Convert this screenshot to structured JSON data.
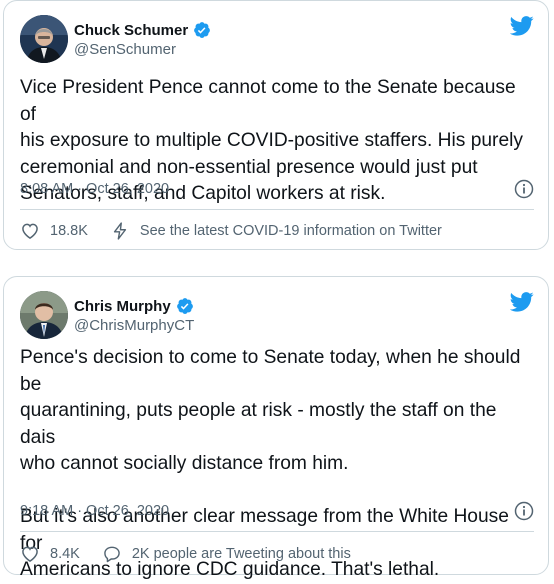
{
  "tweets": [
    {
      "name": "Chuck Schumer",
      "handle": "@SenSchumer",
      "text": "Vice President Pence cannot come to the Senate because of\nhis exposure to multiple COVID-positive staffers. His purely\nceremonial and non-essential presence would just put\nSenators, staff, and Capitol workers at risk.",
      "time": "8:08 AM",
      "sep": "·",
      "date": "Oct 26, 2020",
      "likes": "18.8K",
      "info_link": "See the latest COVID-19 information on Twitter",
      "info_icon": "lightning-icon"
    },
    {
      "name": "Chris Murphy",
      "handle": "@ChrisMurphyCT",
      "text": "Pence's decision to come to Senate today, when he should be\nquarantining, puts people at risk - mostly the staff on the dais\nwho cannot socially distance from him.\n\nBut it's also another clear message from the White House for\nAmericans to ignore CDC guidance. That's lethal.",
      "time": "9:18 AM",
      "sep": "·",
      "date": "Oct 26, 2020",
      "likes": "8.4K",
      "info_link": "2K people are Tweeting about this",
      "info_icon": "speech-bubble-icon"
    }
  ],
  "colors": {
    "twitter_blue": "#1d9bf0",
    "text": "#0f1419",
    "secondary": "#536471",
    "border": "#cfd9de"
  }
}
